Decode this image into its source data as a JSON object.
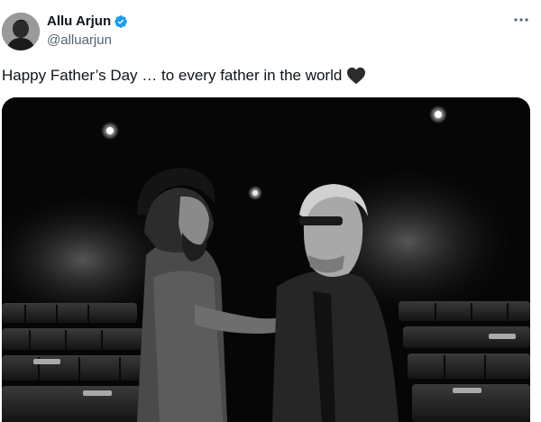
{
  "post": {
    "author": {
      "display_name": "Allu Arjun",
      "handle": "@alluarjun",
      "verified": true,
      "avatar_icon": "avatar-photo"
    },
    "text": "Happy Father’s Day … to every father in the world",
    "emoji": "black-heart",
    "more_icon": "more-options-icon",
    "media": {
      "type": "photo",
      "style": "black-and-white"
    }
  },
  "colors": {
    "verified_blue": "#1d9bf0",
    "text_primary": "#0f1419",
    "text_secondary": "#536471"
  }
}
